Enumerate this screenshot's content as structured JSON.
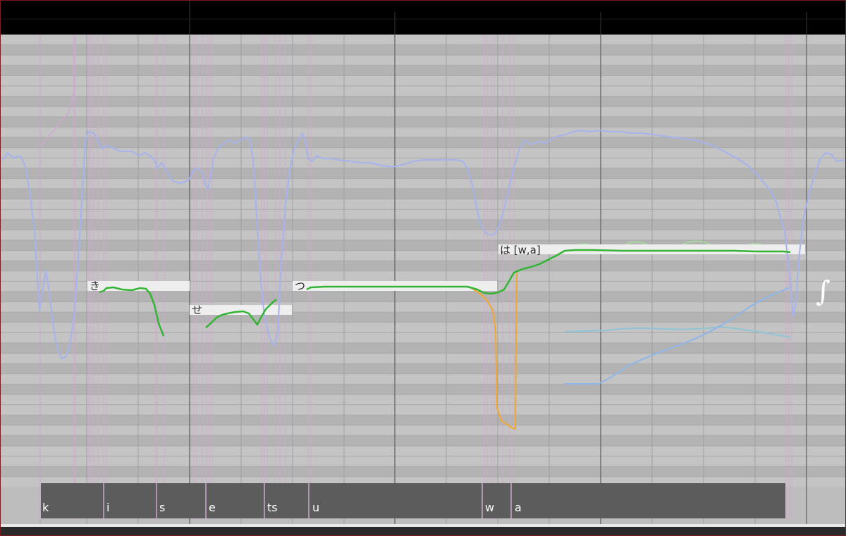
{
  "app": {
    "colors": {
      "header": "#000000",
      "grid_light": "#c4c4c4",
      "grid_dark": "#b3b3b3",
      "grid_line": "#a9a9a9",
      "bar_line": "#6f6f6f",
      "pitch_curve": "#a6b3ec",
      "note_pitch": "#33b533",
      "note_box": "#eeeeee",
      "phoneme_bar": "#5c5c5c",
      "phoneme_marker": "#cfa6cf",
      "orange_curve": "#f0a830",
      "param_curve_1": "#8fc3d6",
      "param_curve_2": "#8fb6e8",
      "vibrato_faint": "#a9d89e"
    }
  },
  "notes": [
    {
      "lyric": "き"
    },
    {
      "lyric": "せ"
    },
    {
      "lyric": "つ"
    },
    {
      "lyric": "は [w,a]"
    }
  ],
  "phonemes": [
    "k",
    "i",
    "s",
    "e",
    "ts",
    "u",
    "w",
    "a"
  ],
  "tool": {
    "icon": "integral-icon",
    "glyph": "∫"
  }
}
